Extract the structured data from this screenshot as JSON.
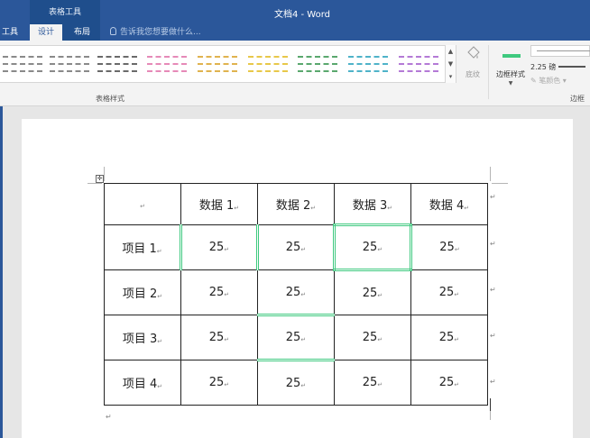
{
  "title_bar": {
    "context_group": "表格工具",
    "window_title": "文档4 - Word"
  },
  "tabs": [
    {
      "label": "工具"
    },
    {
      "label": "设计",
      "active": true
    },
    {
      "label": "布局"
    }
  ],
  "tell_me": {
    "placeholder": "告诉我您想要做什么..."
  },
  "ribbon": {
    "table_styles_label": "表格样式",
    "shading_label": "底纹",
    "border_styles_label": "边框样式",
    "line_weight": "2.25 磅",
    "pen_color_label": "笔颜色",
    "borders_group_label": "边框",
    "style_colors": [
      "#8a8a8a",
      "#8a8a8a",
      "#6a6a6a",
      "#e68ab8",
      "#e0b34f",
      "#e8c84a",
      "#5aa86e",
      "#4fb3c9",
      "#b47ad6"
    ]
  },
  "accent_color": "#3ec97f",
  "paragraph_mark": "↵",
  "table": {
    "header": [
      "",
      "数据 1",
      "数据 2",
      "数据 3",
      "数据 4"
    ],
    "rows": [
      {
        "label": "项目 1",
        "values": [
          "25",
          "25",
          "25",
          "25"
        ]
      },
      {
        "label": "项目 2",
        "values": [
          "25",
          "25",
          "25",
          "25"
        ]
      },
      {
        "label": "项目 3",
        "values": [
          "25",
          "25",
          "25",
          "25"
        ]
      },
      {
        "label": "项目 4",
        "values": [
          "25",
          "25",
          "25",
          "25"
        ]
      }
    ]
  }
}
